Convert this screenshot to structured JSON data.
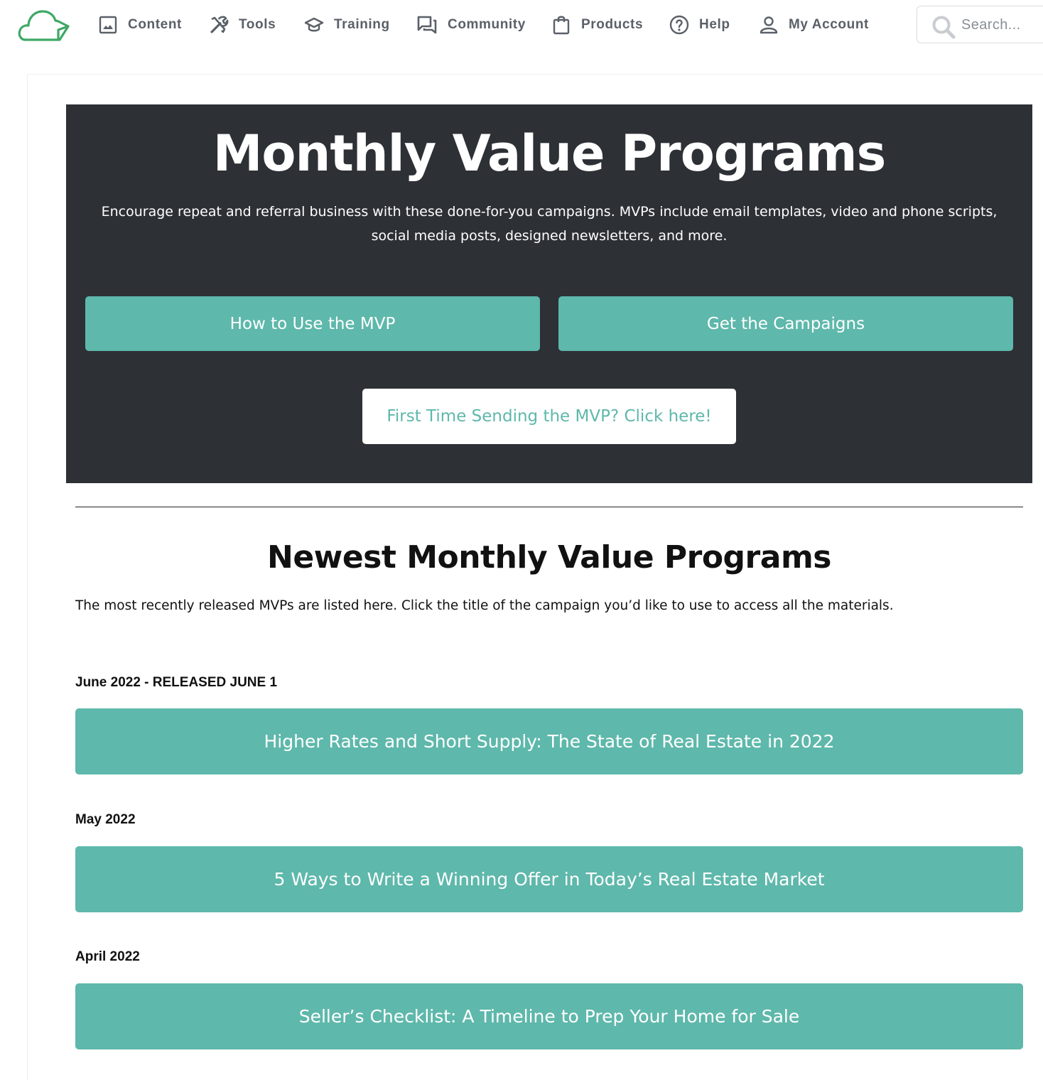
{
  "nav": {
    "logo_icon": "cloud-logo-icon",
    "items": [
      {
        "label": "Content",
        "icon": "image-icon"
      },
      {
        "label": "Tools",
        "icon": "tools-icon"
      },
      {
        "label": "Training",
        "icon": "graduation-cap-icon"
      },
      {
        "label": "Community",
        "icon": "chat-icon"
      },
      {
        "label": "Products",
        "icon": "shopping-bag-icon"
      },
      {
        "label": "Help",
        "icon": "help-circle-icon"
      },
      {
        "label": "My Account",
        "icon": "user-icon"
      }
    ],
    "search": {
      "placeholder": "Search...",
      "value": "",
      "icon": "search-icon"
    }
  },
  "hero": {
    "title": "Monthly Value Programs",
    "description": "Encourage repeat and referral business with these done-for-you campaigns. MVPs include email templates, video and phone scripts, social media posts, designed newsletters, and more.",
    "buttons": [
      {
        "label": "How to Use the MVP"
      },
      {
        "label": "Get the Campaigns"
      },
      {
        "label": "First Time Sending the MVP? Click here!"
      }
    ]
  },
  "newest": {
    "title": "Newest Monthly Value Programs",
    "intro": "The most recently released MVPs are listed here. Click the title of the campaign you’d like to use to access all the materials.",
    "campaigns": [
      {
        "month": "June 2022 - RELEASED JUNE 1",
        "title": "Higher Rates and Short Supply: The State of Real Estate in 2022"
      },
      {
        "month": "May 2022",
        "title": "5 Ways to Write a Winning Offer in Today’s Real Estate Market"
      },
      {
        "month": "April 2022",
        "title": "Seller’s Checklist: A Timeline to Prep Your Home for Sale"
      }
    ]
  },
  "colors": {
    "accent_teal": "#5eb8ab",
    "hero_background": "#2d3035",
    "logo_green": "#3fa866",
    "nav_text": "#5a6068"
  }
}
